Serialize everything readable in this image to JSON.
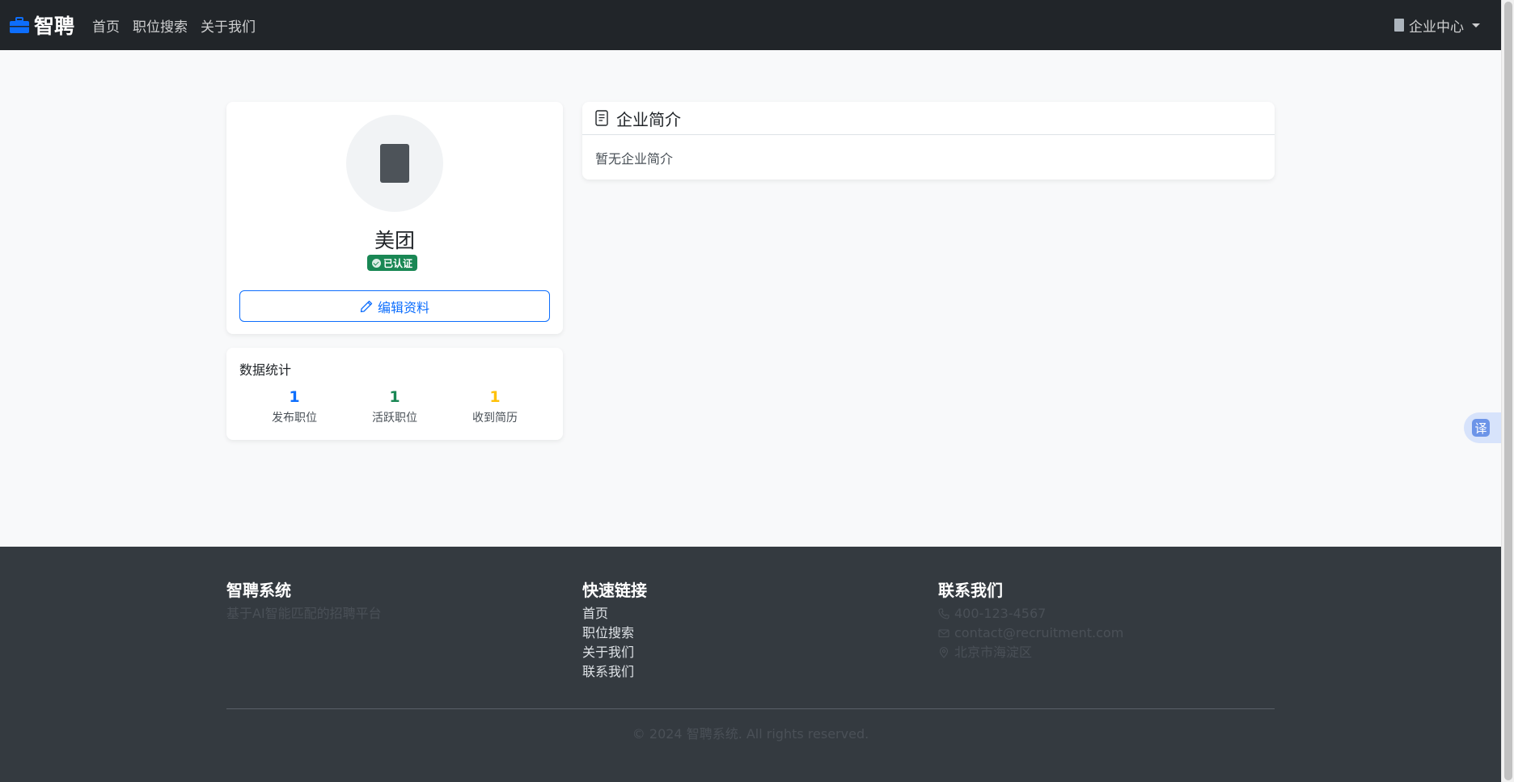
{
  "navbar": {
    "brand": "智聘",
    "links": [
      "首页",
      "职位搜索",
      "关于我们"
    ],
    "user_menu": "企业中心"
  },
  "profile": {
    "company_name": "美团",
    "verified_badge": "已认证",
    "edit_button": "编辑资料"
  },
  "stats": {
    "title": "数据统计",
    "items": [
      {
        "value": "1",
        "label": "发布职位",
        "color": "#0d6efd"
      },
      {
        "value": "1",
        "label": "活跃职位",
        "color": "#198754"
      },
      {
        "value": "1",
        "label": "收到简历",
        "color": "#ffc107"
      }
    ]
  },
  "intro": {
    "title": "企业简介",
    "body": "暂无企业简介"
  },
  "translate": {
    "label": "译"
  },
  "footer": {
    "about_title": "智聘系统",
    "about_text": "基于AI智能匹配的招聘平台",
    "links_title": "快速链接",
    "links": [
      "首页",
      "职位搜索",
      "关于我们",
      "联系我们"
    ],
    "contact_title": "联系我们",
    "phone": "400-123-4567",
    "email": "contact@recruitment.com",
    "address": "北京市海淀区",
    "copyright": "© 2024 智聘系统. All rights reserved."
  },
  "colors": {
    "navbar_bg": "#212529",
    "footer_bg": "#343a40",
    "primary": "#0d6efd",
    "success": "#198754",
    "warning": "#ffc107"
  }
}
